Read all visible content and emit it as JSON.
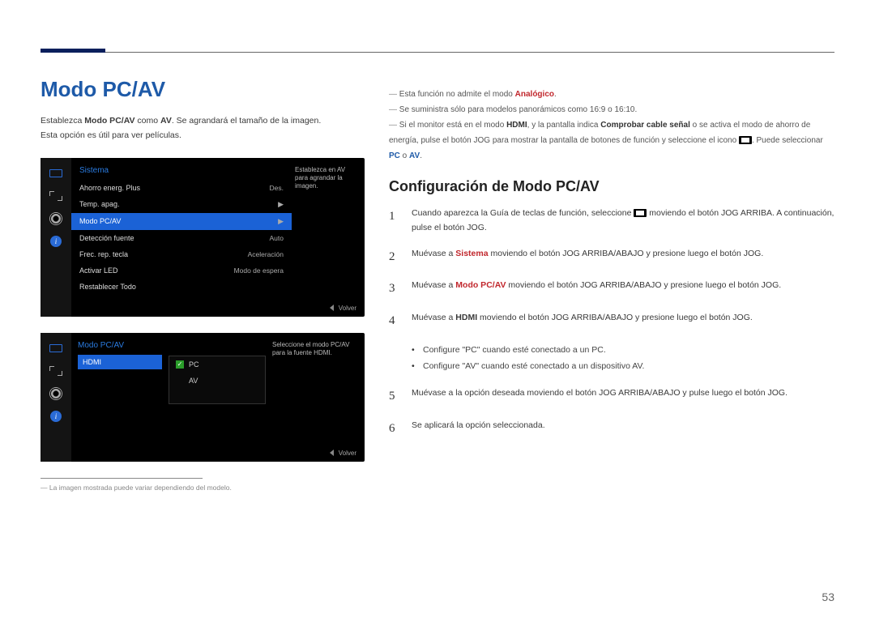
{
  "page_number": "53",
  "title": "Modo PC/AV",
  "intro_line1_a": "Establezca ",
  "intro_line1_b": "Modo PC/AV",
  "intro_line1_c": " como ",
  "intro_line1_d": "AV",
  "intro_line1_e": ". Se agrandará el tamaño de la imagen.",
  "intro_line2": "Esta opción es útil para ver películas.",
  "osd1": {
    "title": "Sistema",
    "desc": "Establezca en AV para agrandar la imagen.",
    "rows": [
      {
        "label": "Ahorro energ. Plus",
        "val": "Des."
      },
      {
        "label": "Temp. apag.",
        "val": "▶"
      },
      {
        "label": "Modo PC/AV",
        "val": "▶"
      },
      {
        "label": "Detección fuente",
        "val": "Auto"
      },
      {
        "label": "Frec. rep. tecla",
        "val": "Aceleración"
      },
      {
        "label": "Activar LED",
        "val": "Modo de espera"
      },
      {
        "label": "Restablecer Todo",
        "val": ""
      }
    ],
    "footer": "Volver"
  },
  "osd2": {
    "title": "Modo PC/AV",
    "left_item": "HDMI",
    "opt_pc": "PC",
    "opt_av": "AV",
    "desc": "Seleccione el modo PC/AV para la fuente HDMI.",
    "footer": "Volver"
  },
  "footnote": "La imagen mostrada puede variar dependiendo del modelo.",
  "notes": {
    "n1_a": "Esta función no admite el modo ",
    "n1_b": "Analógico",
    "n1_c": ".",
    "n2": "Se suministra sólo para modelos panorámicos como 16:9 o 16:10.",
    "n3_a": "Si el monitor está en el modo ",
    "n3_b": "HDMI",
    "n3_c": ", y la pantalla indica ",
    "n3_d": "Comprobar cable señal",
    "n3_e": " o se activa el modo de ahorro de energía, pulse el botón JOG para mostrar la pantalla de botones de función y seleccione el icono ",
    "n3_f": ". Puede seleccionar ",
    "n3_g": "PC",
    "n3_h": " o ",
    "n3_i": "AV",
    "n3_j": "."
  },
  "config_title": "Configuración de Modo PC/AV",
  "steps": {
    "s1_a": "Cuando aparezca la Guía de teclas de función, seleccione ",
    "s1_b": " moviendo el botón JOG ARRIBA. A continuación, pulse el botón JOG.",
    "s2_a": "Muévase a ",
    "s2_b": "Sistema",
    "s2_c": " moviendo el botón JOG ARRIBA/ABAJO y presione luego el botón JOG.",
    "s3_a": "Muévase a ",
    "s3_b": "Modo PC/AV",
    "s3_c": " moviendo el botón JOG ARRIBA/ABAJO y presione luego el botón JOG.",
    "s4_a": "Muévase a ",
    "s4_b": "HDMI",
    "s4_c": " moviendo el botón JOG ARRIBA/ABAJO y presione luego el botón JOG.",
    "b1": "Configure \"PC\" cuando esté conectado a un PC.",
    "b2": "Configure \"AV\" cuando esté conectado a un dispositivo AV.",
    "s5": "Muévase a la opción deseada moviendo el botón JOG ARRIBA/ABAJO y pulse luego el botón JOG.",
    "s6": "Se aplicará la opción seleccionada."
  }
}
